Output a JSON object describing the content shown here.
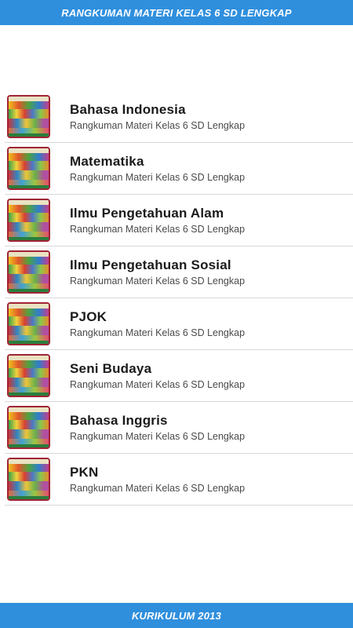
{
  "header": {
    "title": "RANGKUMAN MATERI KELAS 6 SD LENGKAP"
  },
  "list": {
    "items": [
      {
        "title": "Bahasa Indonesia",
        "subtitle": "Rangkuman Materi Kelas 6 SD Lengkap"
      },
      {
        "title": "Matematika",
        "subtitle": "Rangkuman Materi Kelas 6 SD Lengkap"
      },
      {
        "title": "Ilmu Pengetahuan Alam",
        "subtitle": "Rangkuman Materi Kelas 6 SD Lengkap"
      },
      {
        "title": "Ilmu Pengetahuan Sosial",
        "subtitle": "Rangkuman Materi Kelas 6 SD Lengkap"
      },
      {
        "title": "PJOK",
        "subtitle": "Rangkuman Materi Kelas 6 SD Lengkap"
      },
      {
        "title": "Seni Budaya",
        "subtitle": "Rangkuman Materi Kelas 6 SD Lengkap"
      },
      {
        "title": "Bahasa Inggris",
        "subtitle": "Rangkuman Materi Kelas 6 SD Lengkap"
      },
      {
        "title": "PKN",
        "subtitle": "Rangkuman Materi Kelas 6 SD Lengkap"
      }
    ]
  },
  "footer": {
    "title": "KURIKULUM 2013"
  },
  "colors": {
    "bar": "#2f8fdd",
    "thumb_border": "#a02436"
  },
  "icons": {
    "thumbnail": "book-cover-thumbnail-icon"
  }
}
